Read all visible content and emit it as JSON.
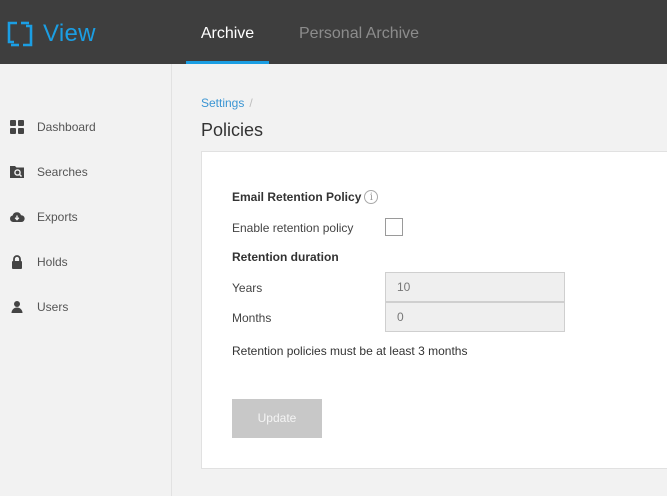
{
  "app": {
    "name": "View"
  },
  "topnav": {
    "tabs": [
      {
        "label": "Archive",
        "active": true
      },
      {
        "label": "Personal Archive",
        "active": false
      }
    ]
  },
  "sidebar": {
    "items": [
      {
        "label": "Dashboard",
        "icon": "dashboard-icon"
      },
      {
        "label": "Searches",
        "icon": "searches-icon"
      },
      {
        "label": "Exports",
        "icon": "cloud-download-icon"
      },
      {
        "label": "Holds",
        "icon": "lock-icon"
      },
      {
        "label": "Users",
        "icon": "user-icon"
      }
    ]
  },
  "breadcrumb": {
    "link": "Settings",
    "separator": "/"
  },
  "page": {
    "title": "Policies"
  },
  "policy": {
    "section_title": "Email Retention Policy",
    "info_icon": "i",
    "enable_label": "Enable retention policy",
    "enable_checked": false,
    "duration_title": "Retention duration",
    "years_label": "Years",
    "years_value": "10",
    "months_label": "Months",
    "months_value": "0",
    "note": "Retention policies must be at least 3 months",
    "update_label": "Update"
  },
  "colors": {
    "accent": "#1b9ee3",
    "topbar": "#3e3e3e",
    "link": "#3a95d3",
    "disabled_button": "#c8c8c8"
  }
}
